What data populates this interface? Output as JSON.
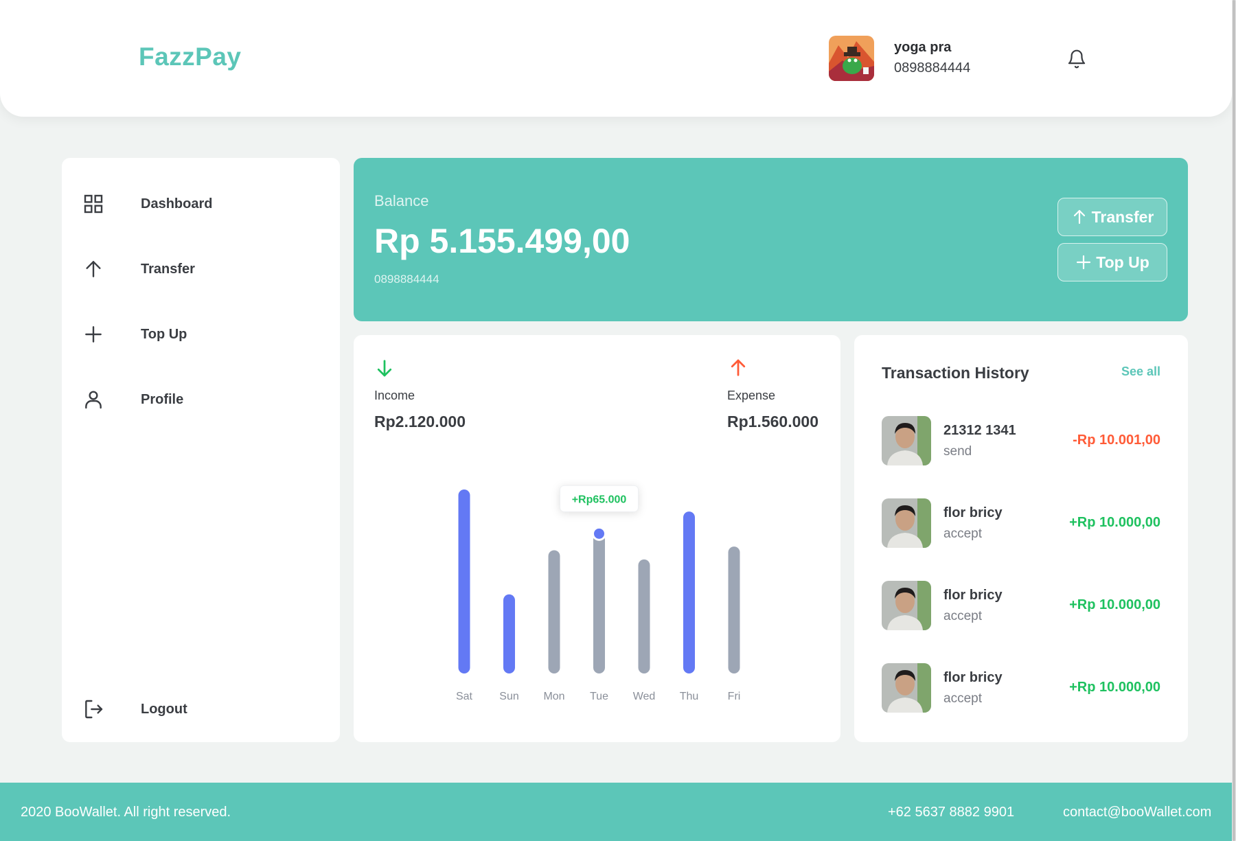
{
  "header": {
    "brand": "FazzPay",
    "user_name": "yoga pra",
    "user_phone": "0898884444",
    "bell_icon": "bell-icon"
  },
  "sidebar": {
    "items": [
      {
        "label": "Dashboard",
        "icon": "grid-icon"
      },
      {
        "label": "Transfer",
        "icon": "arrow-up-icon"
      },
      {
        "label": "Top Up",
        "icon": "plus-icon"
      },
      {
        "label": "Profile",
        "icon": "user-icon"
      }
    ],
    "logout": {
      "label": "Logout",
      "icon": "logout-icon"
    }
  },
  "balance": {
    "label": "Balance",
    "amount": "Rp 5.155.499,00",
    "phone": "0898884444",
    "transfer_label": "Transfer",
    "topup_label": "Top Up"
  },
  "stats": {
    "income_label": "Income",
    "income_value": "Rp2.120.000",
    "expense_label": "Expense",
    "expense_value": "Rp1.560.000",
    "tooltip": "+Rp65.000"
  },
  "chart_data": {
    "type": "bar",
    "categories": [
      "Sat",
      "Sun",
      "Mon",
      "Tue",
      "Wed",
      "Thu",
      "Fri"
    ],
    "values": [
      100,
      43,
      67,
      76,
      62,
      88,
      69
    ],
    "highlight": [
      true,
      true,
      false,
      false,
      false,
      true,
      false
    ],
    "tooltip_index": 3,
    "ylim": [
      0,
      100
    ],
    "colors": {
      "income": "#6379f4",
      "other": "#9da6b5"
    }
  },
  "history": {
    "title": "Transaction History",
    "see_all": "See all",
    "items": [
      {
        "name": "21312 1341",
        "type": "send",
        "amount": "-Rp 10.001,00",
        "direction": "out"
      },
      {
        "name": "flor bricy",
        "type": "accept",
        "amount": "+Rp 10.000,00",
        "direction": "in"
      },
      {
        "name": "flor bricy",
        "type": "accept",
        "amount": "+Rp 10.000,00",
        "direction": "in"
      },
      {
        "name": "flor bricy",
        "type": "accept",
        "amount": "+Rp 10.000,00",
        "direction": "in"
      }
    ]
  },
  "footer": {
    "copyright": "2020 BooWallet. All right reserved.",
    "phone": "+62 5637 8882 9901",
    "email": "contact@booWallet.com"
  },
  "colors": {
    "accent": "#5cc6b8",
    "income": "#1ec15f",
    "expense": "#ff5b37",
    "bar_active": "#6379f4",
    "bar_inactive": "#9da6b5"
  }
}
